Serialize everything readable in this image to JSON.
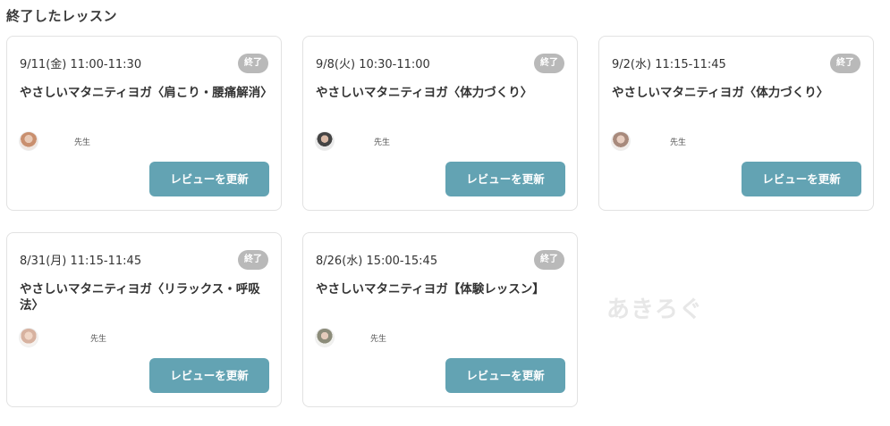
{
  "section": {
    "title": "終了したレッスン"
  },
  "lessons": [
    {
      "date": "9/11(金) 11:00-11:30",
      "status": "終了",
      "title": "やさしいマタニティヨガ〈肩こり・腰痛解消〉",
      "teacher_name": "先生",
      "review_label": "レビューを更新"
    },
    {
      "date": "9/8(火) 10:30-11:00",
      "status": "終了",
      "title": "やさしいマタニティヨガ〈体力づくり〉",
      "teacher_name": "先生",
      "review_label": "レビューを更新"
    },
    {
      "date": "9/2(水) 11:15-11:45",
      "status": "終了",
      "title": "やさしいマタニティヨガ〈体力づくり〉",
      "teacher_name": "先生",
      "review_label": "レビューを更新"
    },
    {
      "date": "8/31(月) 11:15-11:45",
      "status": "終了",
      "title": "やさしいマタニティヨガ〈リラックス・呼吸法〉",
      "teacher_name": "先生",
      "review_label": "レビューを更新"
    },
    {
      "date": "8/26(水) 15:00-15:45",
      "status": "終了",
      "title": "やさしいマタニティヨガ【体験レッスン】",
      "teacher_name": "先生",
      "review_label": "レビューを更新"
    }
  ],
  "watermark": "あきろぐ"
}
